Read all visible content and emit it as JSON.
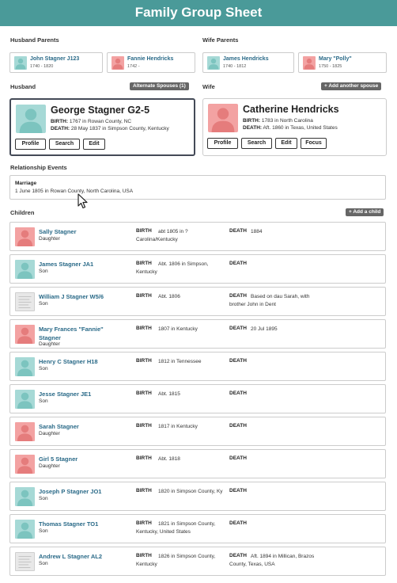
{
  "page_title": "Family Group Sheet",
  "husband_parents_label": "Husband Parents",
  "wife_parents_label": "Wife Parents",
  "husband_parents": [
    {
      "name": "John Stagner J123",
      "dates": "1740 - 1820",
      "gender": "m"
    },
    {
      "name": "Fannie Hendricks",
      "dates": "1742 -",
      "gender": "f"
    }
  ],
  "wife_parents": [
    {
      "name": "James Hendricks",
      "dates": "1740 - 1812",
      "gender": "m"
    },
    {
      "name": "Mary \"Polly\"",
      "dates": "1750 - 1825",
      "gender": "f"
    }
  ],
  "husband_label": "Husband",
  "wife_label": "Wife",
  "alternate_spouses_label": "Alternate Spouses (1)",
  "add_spouse_label": "+ Add another spouse",
  "husband": {
    "name": "George Stagner G2-5",
    "birth_label": "BIRTH:",
    "birth": "1767 in Rowan County, NC",
    "death_label": "DEATH:",
    "death": "28 May 1837 in Simpson County, Kentucky",
    "buttons": [
      "Profile",
      "Search",
      "Edit"
    ]
  },
  "wife": {
    "name": "Catherine Hendricks",
    "birth_label": "BIRTH:",
    "birth": "1783 in North Carolina",
    "death_label": "DEATH:",
    "death": "Aft. 1860 in Texas, United States",
    "buttons": [
      "Profile",
      "Search",
      "Edit",
      "Focus"
    ]
  },
  "events_label": "Relationship Events",
  "marriage": {
    "type": "Marriage",
    "text": "1 June 1805 in Rowan County, North Carolina, USA"
  },
  "children_label": "Children",
  "add_child_label": "+ Add a child",
  "birth_label": "BIRTH",
  "death_label": "DEATH",
  "children": [
    {
      "name": "Sally Stagner",
      "role": "Daughter",
      "gender": "f",
      "birth": "abt 1805 in ? Carolina/Kentucky",
      "death": "1884"
    },
    {
      "name": "James Stagner JA1",
      "role": "Son",
      "gender": "m",
      "birth": "Abt. 1806 in Simpson, Kentucky",
      "death": ""
    },
    {
      "name": "William J Stagner W5/6",
      "role": "Son",
      "gender": "photo",
      "birth": "Abt. 1806",
      "death": "Based on dau Sarah, with brother John in Dent"
    },
    {
      "name": "Mary Frances \"Fannie\" Stagner",
      "role": "Daughter",
      "gender": "f",
      "birth": "1807 in Kentucky",
      "death": "20 Jul 1895"
    },
    {
      "name": "Henry C Stagner H18",
      "role": "Son",
      "gender": "m",
      "birth": "1812 in Tennessee",
      "death": ""
    },
    {
      "name": "Jesse Stagner JE1",
      "role": "Son",
      "gender": "m",
      "birth": "Abt. 1815",
      "death": ""
    },
    {
      "name": "Sarah Stagner",
      "role": "Daughter",
      "gender": "f",
      "birth": "1817 in Kentucky",
      "death": ""
    },
    {
      "name": "Girl 5 Stagner",
      "role": "Daughter",
      "gender": "f",
      "birth": "Abt. 1818",
      "death": ""
    },
    {
      "name": "Joseph P Stagner JO1",
      "role": "Son",
      "gender": "m",
      "birth": "1820 in Simpson County, Ky",
      "death": ""
    },
    {
      "name": "Thomas Stagner TO1",
      "role": "Son",
      "gender": "m",
      "birth": "1821 in Simpson County, Kentucky, United States",
      "death": ""
    },
    {
      "name": "Andrew L Stagner AL2",
      "role": "Son",
      "gender": "photo",
      "birth": "1826 in Simpson County, Kentucky",
      "death": "Aft. 1894 in Millican, Brazos County, Texas, USA"
    }
  ],
  "icons": {
    "avatar": "person-silhouette-icon",
    "cursor": "mouse-pointer-icon"
  },
  "colors": {
    "header": "#4a9a99",
    "male_avatar": "#a6d9d6",
    "female_avatar": "#f3a2a2",
    "name_link": "#2a6a88"
  }
}
